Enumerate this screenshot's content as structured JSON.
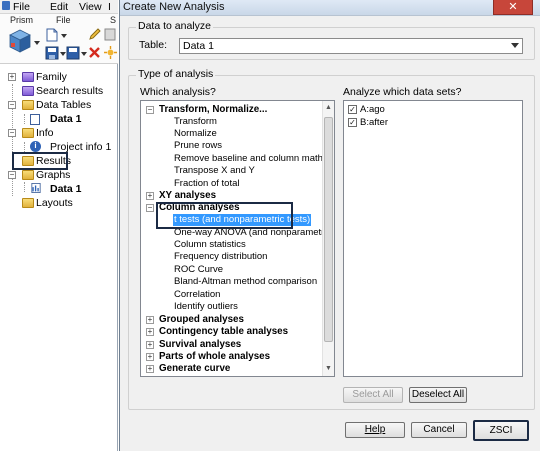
{
  "app": {
    "menu": [
      "File",
      "Edit",
      "View",
      "I"
    ],
    "ribbon_labels": [
      "Prism",
      "File",
      "S"
    ],
    "tree": [
      {
        "label": "Family",
        "bold": false
      },
      {
        "label": "Search results",
        "bold": false
      },
      {
        "label": "Data Tables",
        "bold": false
      },
      {
        "label": "Data 1",
        "bold": true
      },
      {
        "label": "Info",
        "bold": false
      },
      {
        "label": "Project info 1",
        "bold": false
      },
      {
        "label": "Results",
        "bold": false
      },
      {
        "label": "Graphs",
        "bold": false
      },
      {
        "label": "Data 1",
        "bold": true
      },
      {
        "label": "Layouts",
        "bold": false
      }
    ]
  },
  "dialog": {
    "title": "Create New Analysis",
    "close_label": "✕",
    "data_group": {
      "title": "Data to analyze",
      "table_label": "Table:",
      "table_value": "Data 1"
    },
    "type_group": {
      "title": "Type of analysis",
      "which_label": "Which analysis?",
      "datasets_label": "Analyze which data sets?"
    },
    "analysis_list": [
      {
        "label": "Transform, Normalize...",
        "level": 0,
        "expander": "−"
      },
      {
        "label": "Transform",
        "level": 1
      },
      {
        "label": "Normalize",
        "level": 1
      },
      {
        "label": "Prune rows",
        "level": 1
      },
      {
        "label": "Remove baseline and column math",
        "level": 1
      },
      {
        "label": "Transpose X and Y",
        "level": 1
      },
      {
        "label": "Fraction of total",
        "level": 1
      },
      {
        "label": "XY analyses",
        "level": 0,
        "expander": "+"
      },
      {
        "label": "Column analyses",
        "level": 0,
        "expander": "−"
      },
      {
        "label": "t tests (and nonparametric tests)",
        "level": 1,
        "selected": true
      },
      {
        "label": "One-way ANOVA (and nonparametric)",
        "level": 1
      },
      {
        "label": "Column statistics",
        "level": 1
      },
      {
        "label": "Frequency distribution",
        "level": 1
      },
      {
        "label": "ROC Curve",
        "level": 1
      },
      {
        "label": "Bland-Altman method comparison",
        "level": 1
      },
      {
        "label": "Correlation",
        "level": 1
      },
      {
        "label": "Identify outliers",
        "level": 1
      },
      {
        "label": "Grouped analyses",
        "level": 0,
        "expander": "+"
      },
      {
        "label": "Contingency table analyses",
        "level": 0,
        "expander": "+"
      },
      {
        "label": "Survival analyses",
        "level": 0,
        "expander": "+"
      },
      {
        "label": "Parts of whole analyses",
        "level": 0,
        "expander": "+"
      },
      {
        "label": "Generate curve",
        "level": 0,
        "expander": "+"
      }
    ],
    "datasets": [
      {
        "label": "A:ago",
        "checked": true
      },
      {
        "label": "B:after",
        "checked": true
      }
    ],
    "buttons": {
      "select_all": "Select All",
      "deselect_all": "Deselect All",
      "help": "Help",
      "cancel": "Cancel",
      "ok": "ZSCI"
    }
  }
}
